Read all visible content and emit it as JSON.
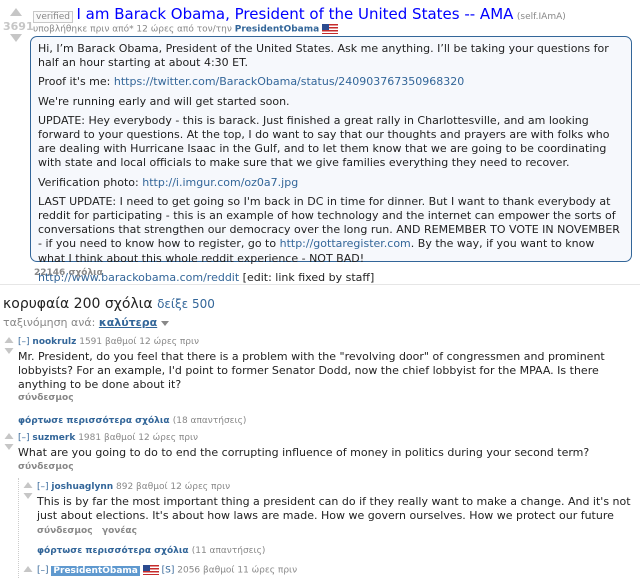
{
  "post": {
    "score": "3691",
    "verified": "verified",
    "title": "I am Barack Obama, President of the United States -- AMA",
    "domain": "(self.IAmA)",
    "submitted": "υποβλήθηκε πριν από* 12 ώρες από τον/την",
    "author": "PresidentObama",
    "body": {
      "p1": "Hi, I’m Barack Obama, President of the United States. Ask me anything. I’ll be taking your questions for half an hour starting at about 4:30 ET.",
      "p2_label": "Proof it's me: ",
      "p2_link": "https://twitter.com/BarackObama/status/240903767350968320",
      "p3": "We're running early and will get started soon.",
      "p4": "UPDATE: Hey everybody - this is barack. Just finished a great rally in Charlottesville, and am looking forward to your questions. At the top, I do want to say that our thoughts and prayers are with folks who are dealing with Hurricane Isaac in the Gulf, and to let them know that we are going to be coordinating with state and local officials to make sure that we give families everything they need to recover.",
      "p5_label": "Verification photo: ",
      "p5_link": "http://i.imgur.com/oz0a7.jpg",
      "p6_a": "LAST UPDATE: I need to get going so I'm back in DC in time for dinner. But I want to thank everybody at reddit for participating - this is an example of how technology and the internet can empower the sorts of conversations that strengthen our democracy over the long run. AND REMEMBER TO VOTE IN NOVEMBER - if you need to know how to register, go to ",
      "p6_link": "http://gottaregister.com",
      "p6_b": ". By the way, if you want to know what I think about this whole reddit experience - NOT BAD!",
      "p7_link": "http://www.barackobama.com/reddit",
      "p7_text": " [edit: link fixed by staff]"
    },
    "comments_count": "22146 σχόλια"
  },
  "comments_header": {
    "title": "κορυφαία 200 σχόλια",
    "show_all": "δείξε 500",
    "sort_label": "ταξινόμηση ανά: ",
    "sort_value": "καλύτερα"
  },
  "comments": [
    {
      "toggle": "[–]",
      "author": "nookrulz",
      "meta": "1591 βαθμοί 12 ώρες πριν",
      "body": "Mr. President, do you feel that there is a problem with the \"revolving door\" of congressmen and prominent lobbyists? For an example, I'd point to former Senator Dodd, now the chief lobbyist for the MPAA. Is there anything to be done about it?",
      "link": "σύνδεσμος",
      "more": "φόρτωσε περισσότερα σχόλια",
      "more_count": "(18 απαντήσεις)"
    },
    {
      "toggle": "[–]",
      "author": "suzmerk",
      "meta": "1981 βαθμοί 12 ώρες πριν",
      "body": "What are you going to do to end the corrupting influence of money in politics during your second term?",
      "link": "σύνδεσμος"
    },
    {
      "toggle": "[–]",
      "author": "joshuaglynn",
      "meta": "892 βαθμοί 12 ώρες πριν",
      "body": "This is by far the most important thing a president can do if they really want to make a change. And it's not just about elections. It's about how laws are made. How we govern ourselves. How we protect our future",
      "link": "σύνδεσμος",
      "parent": "γονέας",
      "more": "φόρτωσε περισσότερα σχόλια",
      "more_count": "(11 απαντήσεις)"
    },
    {
      "toggle": "[–]",
      "author": "PresidentObama",
      "badge": "[S]",
      "meta": "2056 βαθμοί 11 ώρες πριν"
    }
  ]
}
